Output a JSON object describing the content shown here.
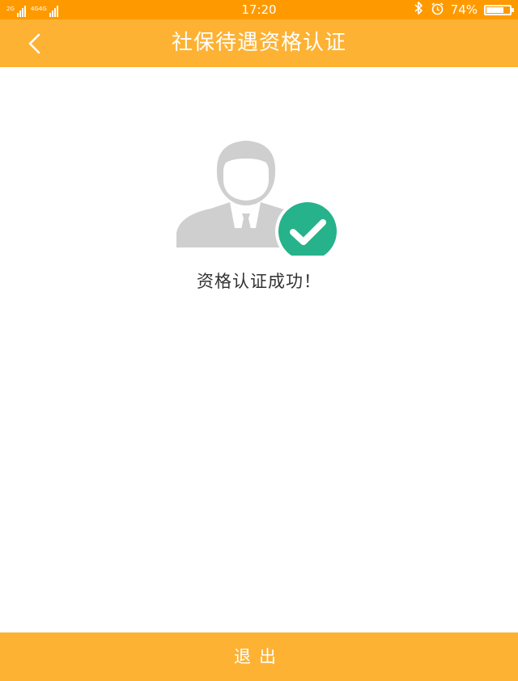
{
  "status_bar": {
    "time": "17:20",
    "battery_percent": "74%",
    "battery_level": 0.74,
    "signal_1_label": "2G",
    "signal_2_label": "4G4G",
    "icons": [
      "bluetooth-icon",
      "alarm-icon",
      "battery-icon"
    ]
  },
  "nav": {
    "title": "社保待遇资格认证",
    "back_icon": "chevron-left-icon"
  },
  "content": {
    "message": "资格认证成功！",
    "avatar_icon": "user-avatar-icon",
    "check_icon": "check-circle-icon"
  },
  "footer": {
    "exit_label": "退出"
  },
  "colors": {
    "status_bar": "#fe9a00",
    "nav_bar": "#fdb234",
    "check_green": "#26b28a",
    "avatar_gray": "#cfcfcf"
  }
}
